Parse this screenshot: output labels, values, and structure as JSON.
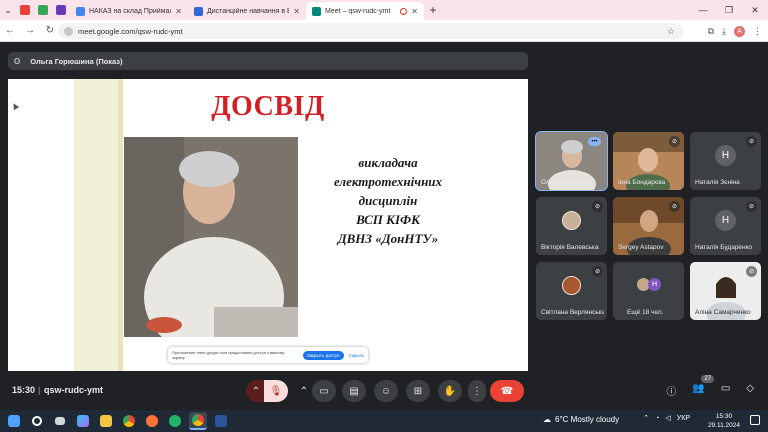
{
  "browser": {
    "tabs": [
      {
        "title": "НАКАЗ на склад Приймальної комісії",
        "favicon_color": "#4285f4",
        "active": false
      },
      {
        "title": "Дистанційне навчання в ВСП",
        "favicon_color": "#3367d6",
        "active": false
      },
      {
        "title": "Meet – qsw-rudc-ymt",
        "favicon_color": "#00897b",
        "active": true
      }
    ],
    "new_tab": "+",
    "url": "meet.google.com/qsw-rudc-ymt",
    "profile_initial": "A"
  },
  "meet": {
    "presenter_label": "Ольга Горюшина (Показ)",
    "slide": {
      "title": "ДОСВІД",
      "body_lines": [
        "викладача",
        "електротехнічних",
        "дисциплін",
        "ВСП   КІФК",
        "ДВНЗ «ДонНТУ»"
      ],
      "share_notice": "Приложение meet.google.com предоставил доступ к вашему экрану.",
      "stop_label": "Закрыть доступ",
      "hide_label": "Скрыть"
    },
    "participants": [
      {
        "name": "Ольга Горюшина",
        "type": "photo",
        "self": true,
        "muted": false
      },
      {
        "name": "Інна Бондарєва",
        "type": "photo",
        "self": false,
        "muted": true
      },
      {
        "name": "Наталія Зєніна",
        "type": "initial",
        "initial": "Н",
        "color": "#5f6368",
        "muted": true
      },
      {
        "name": "Вікторія Валевська",
        "type": "photo-avatar",
        "muted": true
      },
      {
        "name": "Sergey Astapov",
        "type": "photo",
        "muted": true
      },
      {
        "name": "Наталія Бударенко",
        "type": "initial",
        "initial": "Н",
        "color": "#5f6368",
        "muted": true
      },
      {
        "name": "Світлана Верлянська",
        "type": "photo-avatar",
        "muted": true
      },
      {
        "name": "Ещё 18 чел.",
        "type": "more",
        "mini_initial": "Н",
        "muted": false
      },
      {
        "name": "Аліна Самарченко",
        "type": "photo",
        "muted": true
      }
    ],
    "controls": {
      "time": "15:30",
      "divider": "|",
      "meeting_code": "qsw-rudc-ymt",
      "participants_badge": "27"
    }
  },
  "taskbar": {
    "weather": "6°C  Mostly cloudy",
    "language": "УКР",
    "time": "15:30",
    "date": "29.11.2024"
  },
  "icons": {
    "back": "←",
    "forward": "→",
    "reload": "↻",
    "star": "☆",
    "mic_off": "🎙",
    "more": "⋮",
    "hangup": "☎",
    "info": "ⓘ",
    "chat": "💬"
  }
}
